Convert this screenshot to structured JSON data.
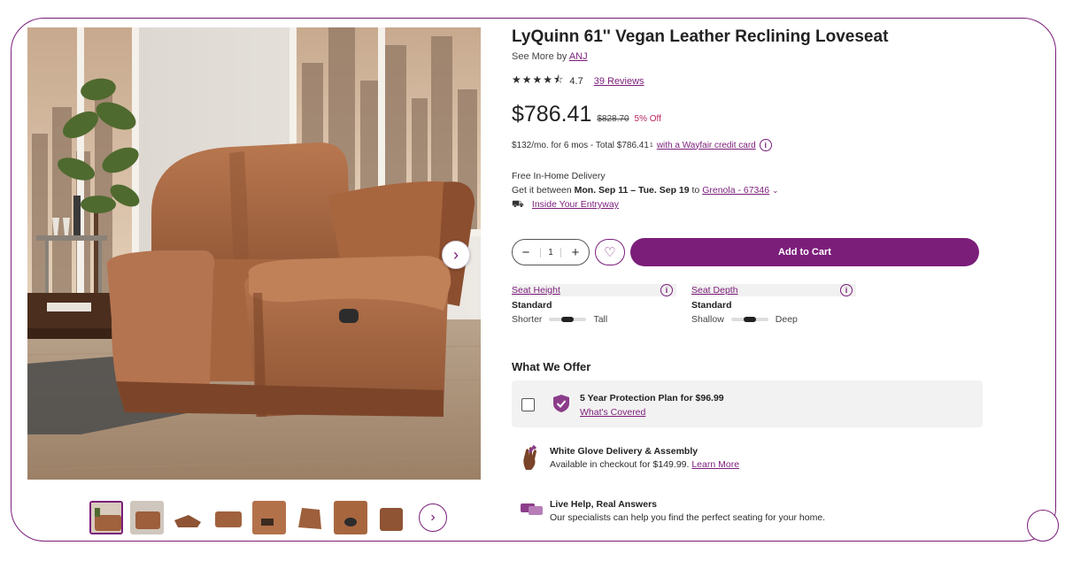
{
  "product": {
    "title": "LyQuinn 61'' Vegan Leather Reclining Loveseat",
    "see_more_prefix": "See More by",
    "brand": "ANJ",
    "stars_glyphs": "★★★★⯪",
    "rating": "4.7",
    "reviews": "39 Reviews",
    "price": "$786.41",
    "was_price": "$828.70",
    "discount": "5% Off",
    "financing_text": "$132/mo. for 6 mos - Total $786.41",
    "financing_sup": "1",
    "financing_link": "with a Wayfair credit card"
  },
  "delivery": {
    "line1": "Free In-Home Delivery",
    "line2_prefix": "Get it between",
    "dates": "Mon. Sep 11 – Tue. Sep 19",
    "to": "to",
    "location": "Grenola - 67346",
    "method": "Inside Your Entryway"
  },
  "buy": {
    "minus": "−",
    "quantity": "1",
    "plus": "+",
    "add_to_cart": "Add to Cart"
  },
  "dimensions": [
    {
      "label": "Seat Height",
      "value": "Standard",
      "low": "Shorter",
      "high": "Tall",
      "level": 0.5
    },
    {
      "label": "Seat Depth",
      "value": "Standard",
      "low": "Shallow",
      "high": "Deep",
      "level": 0.5
    }
  ],
  "offers": {
    "section_title": "What We Offer",
    "protection_title": "5 Year Protection Plan for $96.99",
    "protection_link": "What's Covered",
    "glove_title": "White Glove Delivery & Assembly",
    "glove_text": "Available in checkout for $149.99.",
    "glove_link": "Learn More",
    "help_title": "Live Help, Real Answers",
    "help_text": "Our specialists can help you find the perfect seating for your home."
  },
  "colors": {
    "brand": "#7b1e7a",
    "sale": "#b8245f",
    "leather": "#a0613d"
  },
  "icons": [
    "chevron-right-icon",
    "heart-icon",
    "info-icon",
    "truck-icon",
    "shield-check-icon",
    "glove-icon",
    "chat-icon",
    "chevron-down-icon"
  ]
}
